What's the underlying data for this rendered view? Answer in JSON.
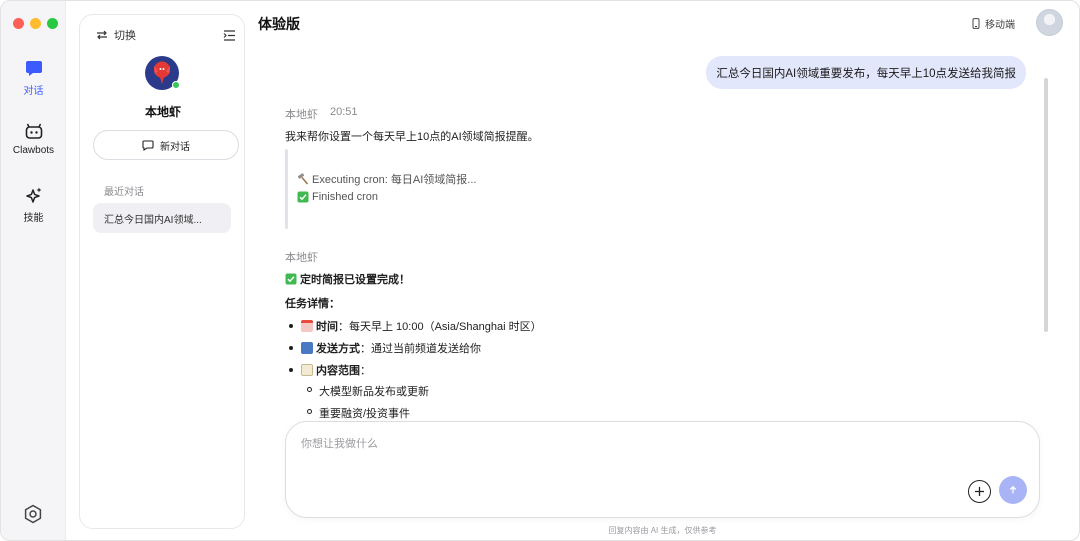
{
  "app": {
    "title": "体验版",
    "mobile_label": "移动端"
  },
  "rail": {
    "items": [
      {
        "label": "对话",
        "active": true
      },
      {
        "label": "Clawbots",
        "active": false
      },
      {
        "label": "技能",
        "active": false
      }
    ]
  },
  "sidebar": {
    "switch_label": "切换",
    "agent_name": "本地虾",
    "new_chat_label": "新对话",
    "recent_title": "最近对话",
    "recent_items": [
      "汇总今日国内AI领域..."
    ]
  },
  "chat": {
    "user_message": "汇总今日国内AI领域重要发布，每天早上10点发送给我简报",
    "reply1": {
      "sender": "本地虾",
      "time": "20:51",
      "text": "我来帮你设置一个每天早上10点的AI领域简报提醒。",
      "tool_lines": [
        "Executing cron: 每日AI领域简报...",
        "Finished cron"
      ]
    },
    "reply2": {
      "sender": "本地虾",
      "done_title": "定时简报已设置完成！",
      "details_title": "任务详情：",
      "items": [
        {
          "label": "时间",
          "value": "：每天早上 10:00（Asia/Shanghai 时区）"
        },
        {
          "label": "发送方式",
          "value": "：通过当前频道发送给你"
        },
        {
          "label": "内容范围",
          "value": "："
        }
      ],
      "sub_items": [
        "大模型新品发布或更新",
        "重要融资/投资事件"
      ]
    }
  },
  "composer": {
    "placeholder": "你想让我做什么"
  },
  "footer": {
    "disclaimer": "回复内容由 AI 生成，仅供参考"
  },
  "colors": {
    "accent": "#3b5bfd",
    "user_bubble": "#e3e7fb",
    "send_button": "#a9b4f7",
    "online": "#34c759"
  }
}
